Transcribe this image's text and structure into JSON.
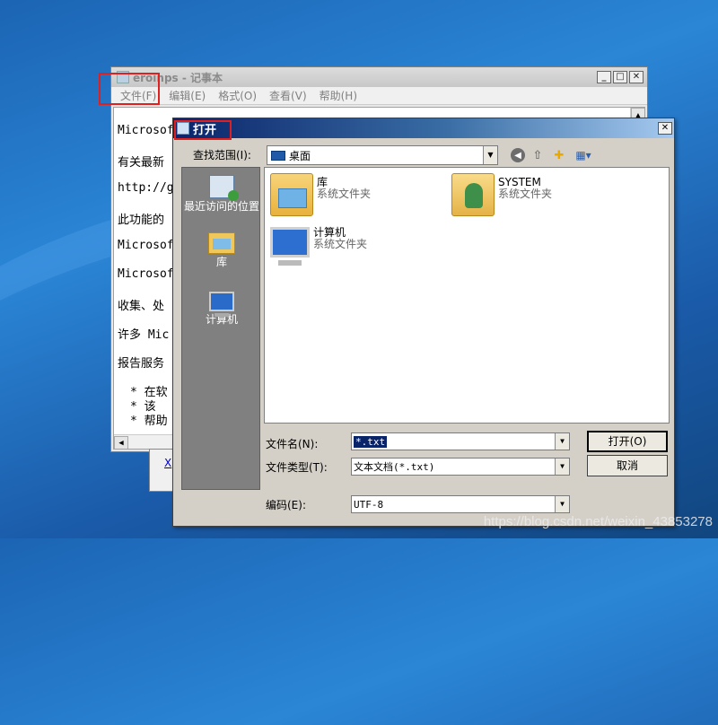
{
  "watermark": "https://blog.csdn.net/weixin_43853278",
  "notepad": {
    "title": "eroinps - 记事本",
    "window_buttons": {
      "minimize": "_",
      "maximize": "□",
      "close": "✕"
    },
    "menu": [
      "文件(F)",
      "编辑(E)",
      "格式(O)",
      "查看(V)",
      "帮助(H)"
    ],
    "lines": [
      "Microsof",
      "有关最新",
      "http://g",
      "此功能的",
      "Microsof",
      "Microsof",
      "收集、处",
      "许多 Mic",
      "报告服务"
    ],
    "bullets": [
      "*  在软",
      "*  该",
      "*  帮助"
    ]
  },
  "back_dialog": {
    "link_text": "X"
  },
  "dialog": {
    "title": "打开",
    "close": "✕",
    "look_in": {
      "label": "查找范围(I):",
      "value": "桌面"
    },
    "places": [
      {
        "label": "最近访问的位置",
        "icon": "recent-places-icon"
      },
      {
        "label": "库",
        "icon": "library-icon"
      },
      {
        "label": "计算机",
        "icon": "computer-icon"
      }
    ],
    "toolbar_icons": [
      "back-icon",
      "up-folder-icon",
      "new-folder-icon",
      "views-menu-icon"
    ],
    "files": [
      {
        "name": "库",
        "type": "系统文件夹",
        "icon": "library-folder-icon"
      },
      {
        "name": "SYSTEM",
        "type": "系统文件夹",
        "icon": "user-folder-icon"
      },
      {
        "name": "计算机",
        "type": "系统文件夹",
        "icon": "computer-icon"
      }
    ],
    "filename": {
      "label": "文件名(N):",
      "value": "*.txt"
    },
    "filetype": {
      "label": "文件类型(T):",
      "value": "文本文档(*.txt)"
    },
    "encoding": {
      "label": "编码(E):",
      "value": "UTF-8"
    },
    "open_button": "打开(O)",
    "cancel_button": "取消"
  }
}
